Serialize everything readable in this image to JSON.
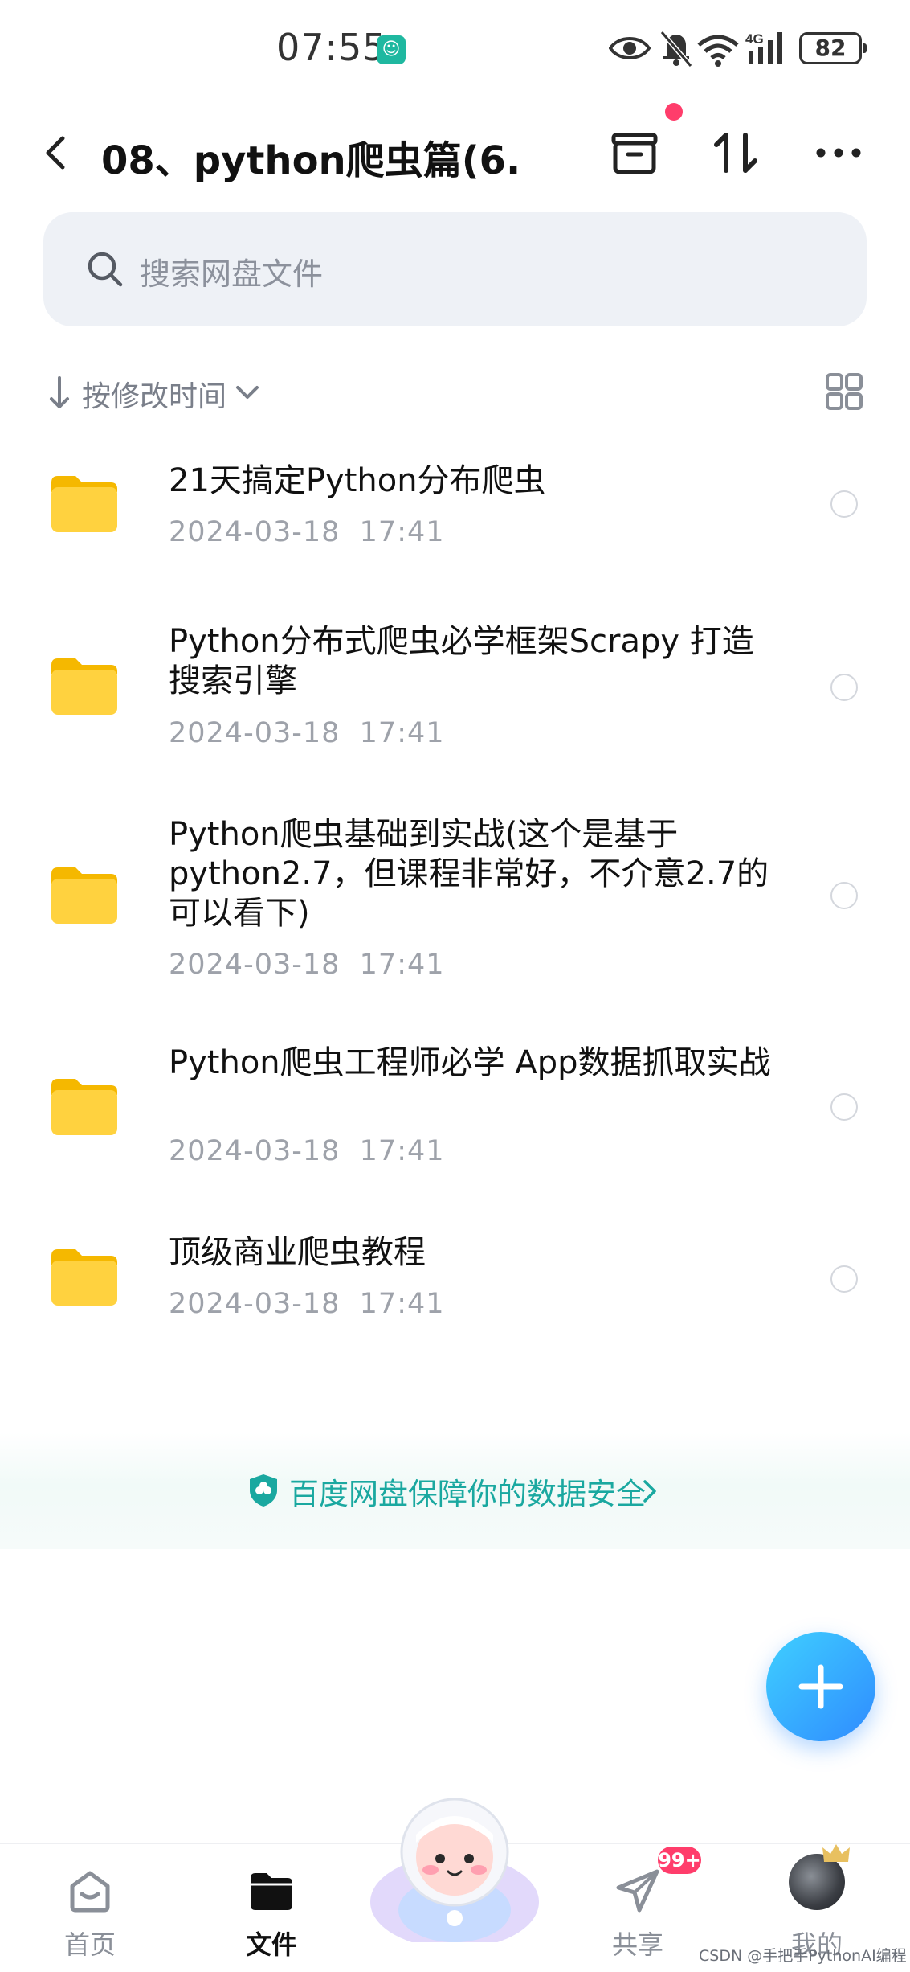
{
  "status_bar": {
    "time": "07:55",
    "battery": "82",
    "network": "4G",
    "icons": [
      "eye-icon",
      "mute-bell-icon",
      "wifi-icon",
      "signal-icon",
      "battery-icon"
    ]
  },
  "header": {
    "title": "08、python爬虫篇(6..."
  },
  "search": {
    "placeholder": "搜索网盘文件"
  },
  "sort": {
    "label": "按修改时间"
  },
  "files": [
    {
      "name": "21天搞定Python分布爬虫",
      "date": "2024-03-18  17:41"
    },
    {
      "name": "Python分布式爬虫必学框架Scrapy 打造搜索引擎",
      "date": "2024-03-18  17:41"
    },
    {
      "name": "Python爬虫基础到实战(这个是基于python2.7，但课程非常好，不介意2.7的可以看下)",
      "date": "2024-03-18  17:41"
    },
    {
      "name": "Python爬虫工程师必学 App数据抓取实战",
      "date": "2024-03-18  17:41"
    },
    {
      "name": "顶级商业爬虫教程",
      "date": "2024-03-18  17:41"
    }
  ],
  "banner": {
    "text": "百度网盘保障你的数据安全"
  },
  "nav": {
    "home": "首页",
    "files": "文件",
    "share": "共享",
    "share_badge": "99+",
    "mine": "我的"
  },
  "watermark": "CSDN @手把手PythonAI编程",
  "colors": {
    "accent": "#2f8bff",
    "security": "#1aa8a0",
    "badge": "#ff3d6b",
    "folder": "#ffd23f"
  }
}
